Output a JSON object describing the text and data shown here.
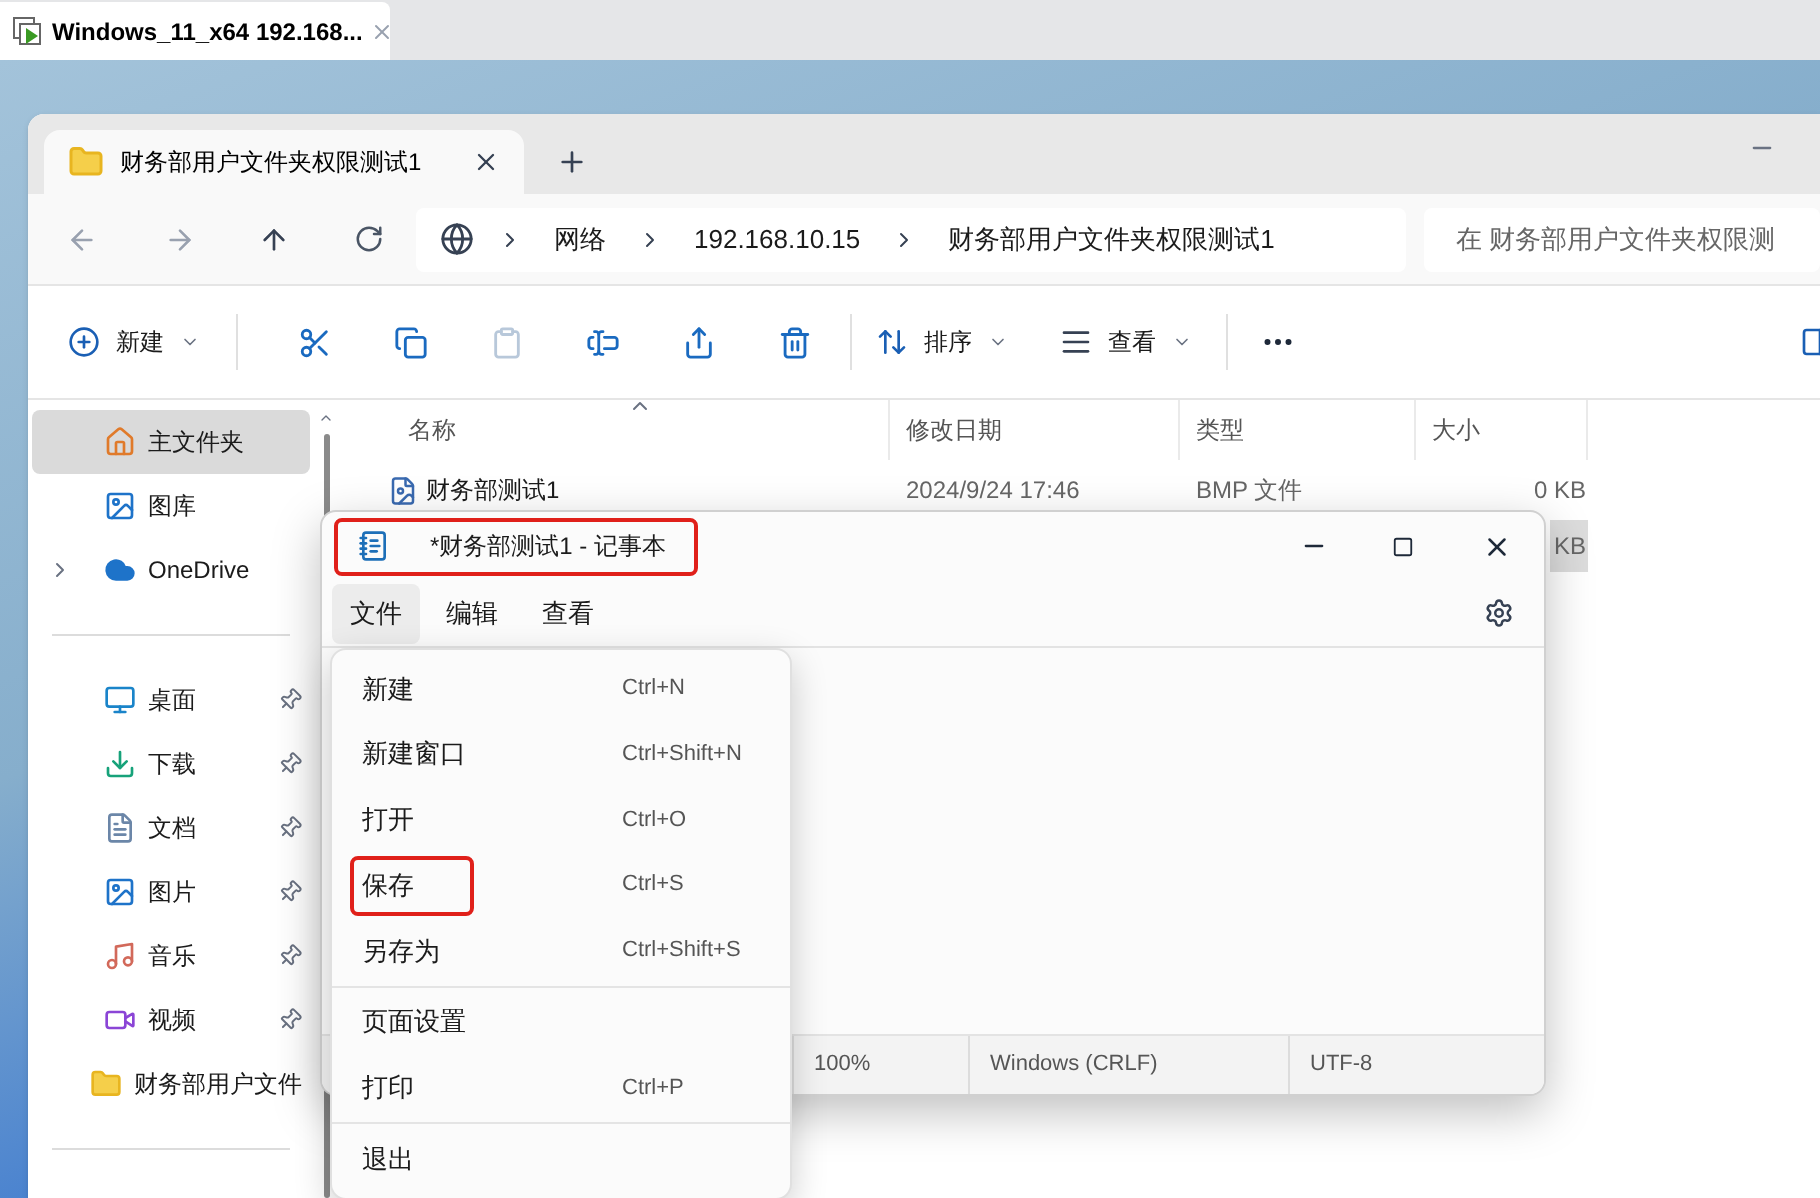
{
  "host_tab": {
    "title": "Windows_11_x64 192.168..."
  },
  "explorer": {
    "tab": {
      "title": "财务部用户文件夹权限测试1"
    },
    "breadcrumb": [
      "网络",
      "192.168.10.15",
      "财务部用户文件夹权限测试1"
    ],
    "search": {
      "placeholder": "在 财务部用户文件夹权限测"
    },
    "toolbar": {
      "new_label": "新建",
      "actions": [
        {
          "kind": "cut",
          "disabled": false
        },
        {
          "kind": "copy",
          "disabled": false
        },
        {
          "kind": "paste",
          "disabled": true
        },
        {
          "kind": "rename",
          "disabled": false
        },
        {
          "kind": "share",
          "disabled": false
        },
        {
          "kind": "delete",
          "disabled": false
        }
      ],
      "sort_label": "排序",
      "view_label": "查看"
    },
    "sidebar": {
      "sections": [
        [
          {
            "kind": "home",
            "label": "主文件夹",
            "selected": true,
            "pinned": false
          },
          {
            "kind": "gallery",
            "label": "图库",
            "selected": false,
            "pinned": false
          },
          {
            "kind": "cloud",
            "label": "OneDrive",
            "selected": false,
            "pinned": false,
            "expanded": false
          }
        ],
        [
          {
            "kind": "desktop",
            "label": "桌面",
            "selected": false,
            "pinned": true
          },
          {
            "kind": "download",
            "label": "下载",
            "selected": false,
            "pinned": true
          },
          {
            "kind": "document",
            "label": "文档",
            "selected": false,
            "pinned": true
          },
          {
            "kind": "picture",
            "label": "图片",
            "selected": false,
            "pinned": true
          },
          {
            "kind": "music",
            "label": "音乐",
            "selected": false,
            "pinned": true
          },
          {
            "kind": "video",
            "label": "视频",
            "selected": false,
            "pinned": true
          },
          {
            "kind": "folder",
            "label": "财务部用户文件",
            "selected": false,
            "pinned": false
          }
        ]
      ]
    },
    "table": {
      "columns": [
        "名称",
        "修改日期",
        "类型",
        "大小"
      ],
      "rows": [
        {
          "name": "财务部测试1",
          "date": "2024/9/24 17:46",
          "type": "BMP 文件",
          "size": "0 KB",
          "selected": false
        },
        {
          "size": "KB",
          "selected": true
        }
      ]
    }
  },
  "notepad": {
    "title": "*财务部测试1 - 记事本",
    "title_annotated": true,
    "menus": [
      {
        "label": "文件",
        "selected": true
      },
      {
        "label": "编辑",
        "selected": false
      },
      {
        "label": "查看",
        "selected": false
      }
    ],
    "status": [
      "100%",
      "Windows (CRLF)",
      "UTF-8"
    ],
    "file_menu": [
      {
        "kind": "item",
        "label": "新建",
        "shortcut": "Ctrl+N",
        "annotated": false
      },
      {
        "kind": "item",
        "label": "新建窗口",
        "shortcut": "Ctrl+Shift+N",
        "annotated": false
      },
      {
        "kind": "item",
        "label": "打开",
        "shortcut": "Ctrl+O",
        "annotated": false
      },
      {
        "kind": "item",
        "label": "保存",
        "shortcut": "Ctrl+S",
        "annotated": true
      },
      {
        "kind": "item",
        "label": "另存为",
        "shortcut": "Ctrl+Shift+S",
        "annotated": false
      },
      {
        "kind": "separator"
      },
      {
        "kind": "item",
        "label": "页面设置",
        "annotated": false
      },
      {
        "kind": "item",
        "label": "打印",
        "shortcut": "Ctrl+P",
        "annotated": false
      },
      {
        "kind": "separator"
      },
      {
        "kind": "item",
        "label": "退出",
        "annotated": false
      }
    ]
  }
}
